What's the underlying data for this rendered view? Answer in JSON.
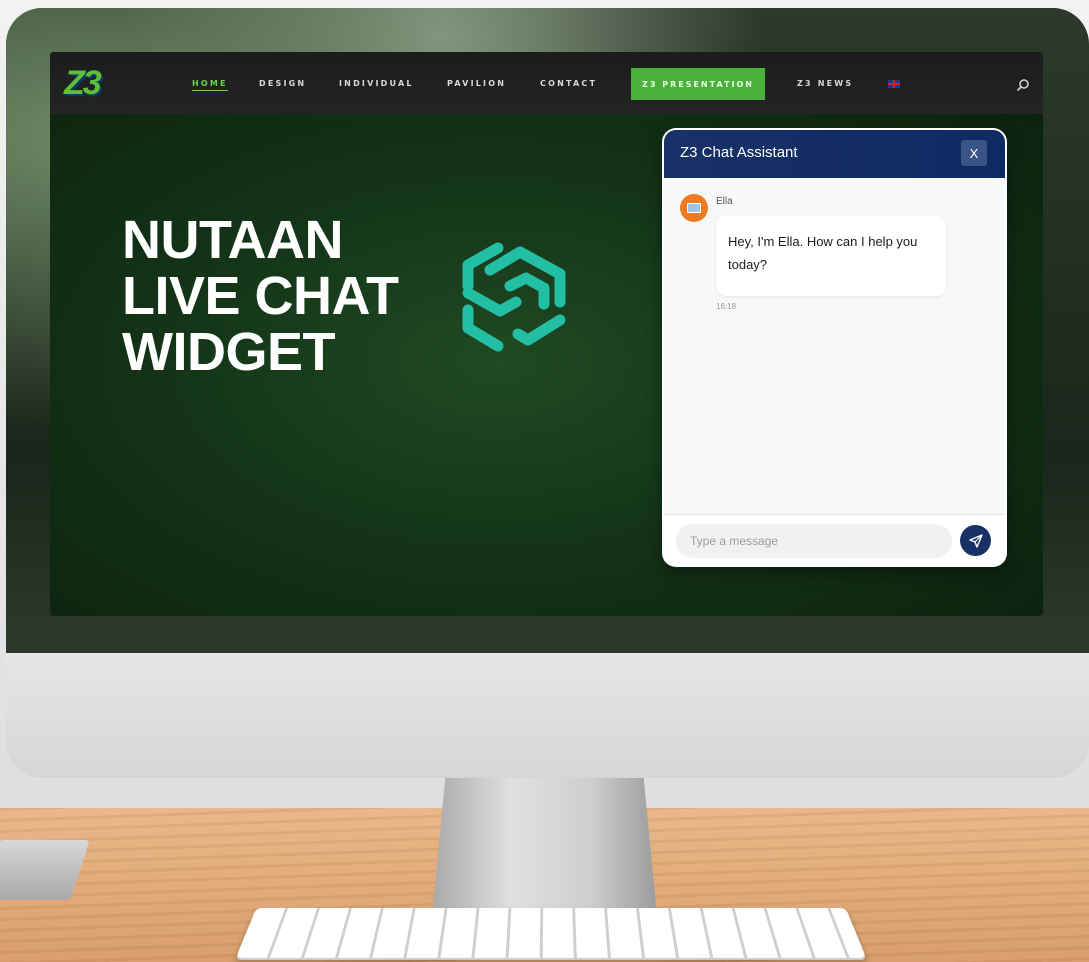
{
  "nav": {
    "items": [
      "HOME",
      "DESIGN",
      "INDIVIDUAL",
      "PAVILION",
      "CONTACT",
      "Z3 NEWS"
    ],
    "cta": "Z3 PRESENTATION",
    "logo": "Z3",
    "search_icon": "search-icon",
    "flag_icon": "uk-flag-icon"
  },
  "hero": {
    "line1": "NUTAAN",
    "line2": "LIVE CHAT",
    "line3": "WIDGET",
    "brand_icon": "nutaan-hex-logo-icon",
    "brand_color": "#22bfa5"
  },
  "chat": {
    "title": "Z3 Chat Assistant",
    "close_label": "X",
    "agent_name": "Ella",
    "message": "Hey, I'm Ella. How can I help you today?",
    "time": "16:18",
    "input_placeholder": "Type a message",
    "send_icon": "send-icon",
    "header_color": "#183166"
  },
  "colors": {
    "accent_green": "#4bb13c",
    "nav_bg": "#1b1d1b"
  }
}
